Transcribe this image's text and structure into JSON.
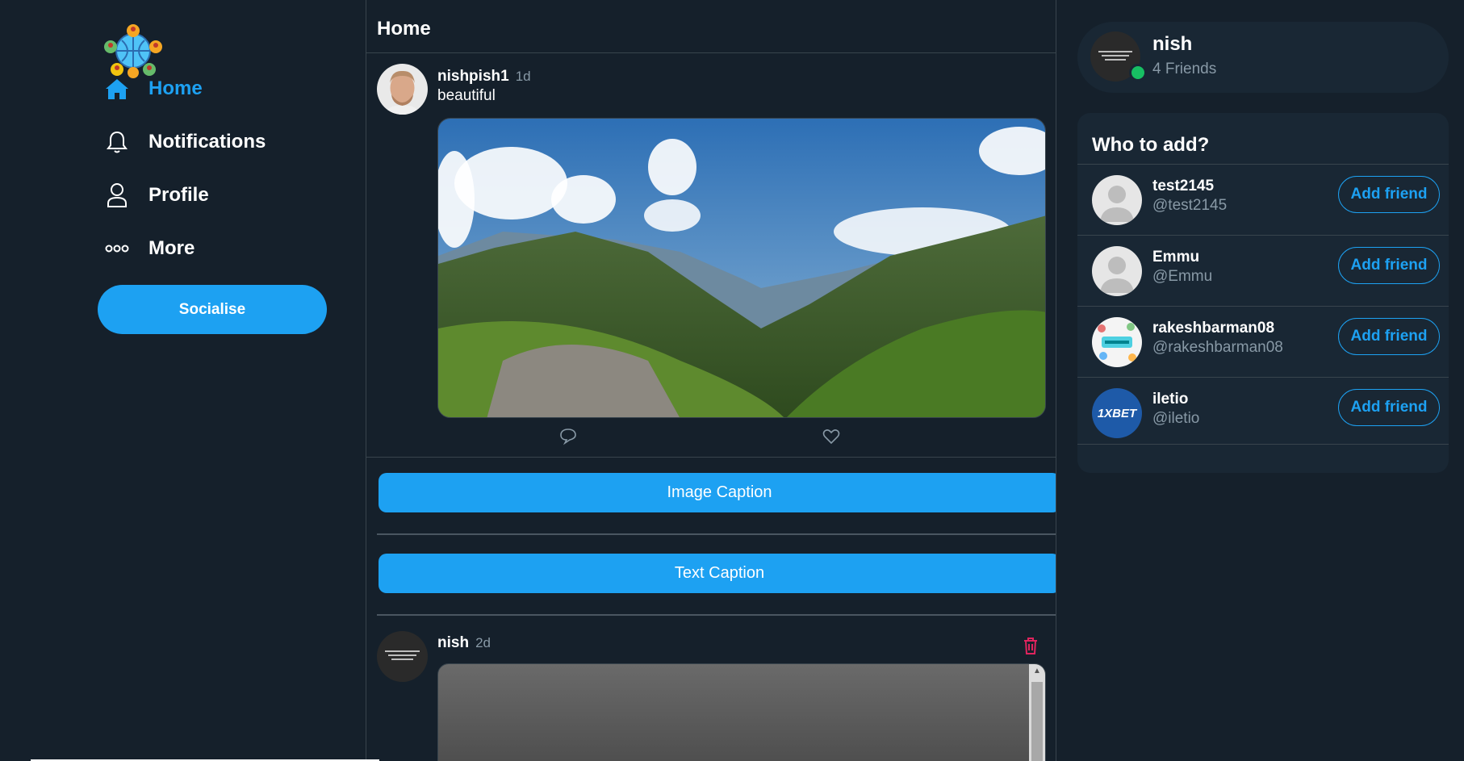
{
  "sidebar": {
    "nav": [
      {
        "label": "Home",
        "icon": "home-icon",
        "active": true
      },
      {
        "label": "Notifications",
        "icon": "bell-icon"
      },
      {
        "label": "Profile",
        "icon": "user-icon"
      },
      {
        "label": "More",
        "icon": "more-icon"
      }
    ],
    "cta_label": "Socialise"
  },
  "feed": {
    "title": "Home",
    "posts": [
      {
        "user": "nishpish1",
        "time": "1d",
        "text": "beautiful"
      },
      {
        "user": "nish",
        "time": "2d"
      }
    ],
    "image_caption_label": "Image Caption",
    "text_caption_label": "Text Caption"
  },
  "profile": {
    "name": "nish",
    "friends": "4 Friends",
    "status": "online"
  },
  "who": {
    "title": "Who to add?",
    "users": [
      {
        "name": "test2145",
        "handle": "@test2145",
        "button": "Add friend"
      },
      {
        "name": "Emmu",
        "handle": "@Emmu",
        "button": "Add friend"
      },
      {
        "name": "rakeshbarman08",
        "handle": "@rakeshbarman08",
        "button": "Add friend"
      },
      {
        "name": "iletio",
        "handle": "@iletio",
        "button": "Add friend"
      }
    ]
  },
  "avatar_badges": {
    "iletio": "1XBET"
  },
  "colors": {
    "accent": "#1da1f2",
    "background": "#15202b",
    "card": "#192734",
    "danger": "#e0245e",
    "online": "#17bf63"
  }
}
